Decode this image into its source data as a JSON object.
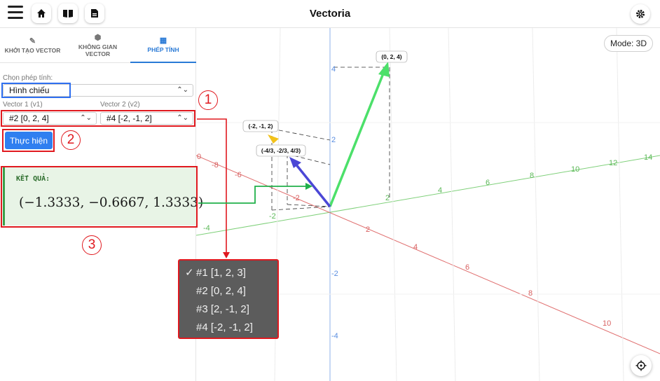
{
  "app": {
    "title": "Vectoria"
  },
  "toolbar": {
    "icons": [
      "menu-icon",
      "home-icon",
      "book-icon",
      "document-icon",
      "gear-icon"
    ]
  },
  "tabs": [
    {
      "label": "KHỞI TẠO VECTOR",
      "icon": "edit-icon",
      "glyph": "✎"
    },
    {
      "label": "KHÔNG GIAN VECTOR",
      "icon": "cube-icon",
      "glyph": "⬢"
    },
    {
      "label": "PHÉP TÍNH",
      "icon": "calculator-icon",
      "glyph": "▦",
      "active": true
    }
  ],
  "form": {
    "operation_label": "Chọn phép tính:",
    "operation_value": "Hình chiếu",
    "v1_label": "Vector 1 (v1)",
    "v1_value": "#2 [0, 2, 4]",
    "v2_label": "Vector 2 (v2)",
    "v2_value": "#4 [-2, -1, 2]",
    "run_label": "Thực hiện"
  },
  "result": {
    "label": "KẾT QUẢ:",
    "value": "(−1.3333,  −0.6667,  1.3333)"
  },
  "annotations": {
    "step1": "1",
    "step2": "2",
    "step3": "3"
  },
  "dropdown": {
    "options": [
      "#1 [1, 2, 3]",
      "#2 [0, 2, 4]",
      "#3 [2, -1, 2]",
      "#4 [-2, -1, 2]"
    ],
    "checked_index": 0,
    "check_glyph": "✓"
  },
  "canvas": {
    "mode_label": "Mode: 3D",
    "vector_labels": [
      "(0, 2, 4)",
      "(-2, -1, 2)",
      "(-4/3, -2/3, 4/3)"
    ],
    "axis_ticks": {
      "z_blue": [
        "4",
        "2",
        "-2",
        "-4"
      ],
      "y_green": [
        "2",
        "4",
        "6",
        "8",
        "10",
        "12",
        "14",
        "-2",
        "-4"
      ],
      "x_red": [
        "2",
        "4",
        "6",
        "8",
        "10",
        "-2",
        "-6",
        "-8",
        "0"
      ]
    },
    "colors": {
      "vector_v1": "#4ce06a",
      "vector_v2": "#f2c21b",
      "vector_projection": "#4b47d6",
      "axis_x": "#e07070",
      "axis_y": "#7fd07a",
      "axis_z": "#8fb2e8",
      "annotation": "#e0191f",
      "highlight": "#2e6ff0",
      "arrow_connector": "#20b04a"
    }
  }
}
